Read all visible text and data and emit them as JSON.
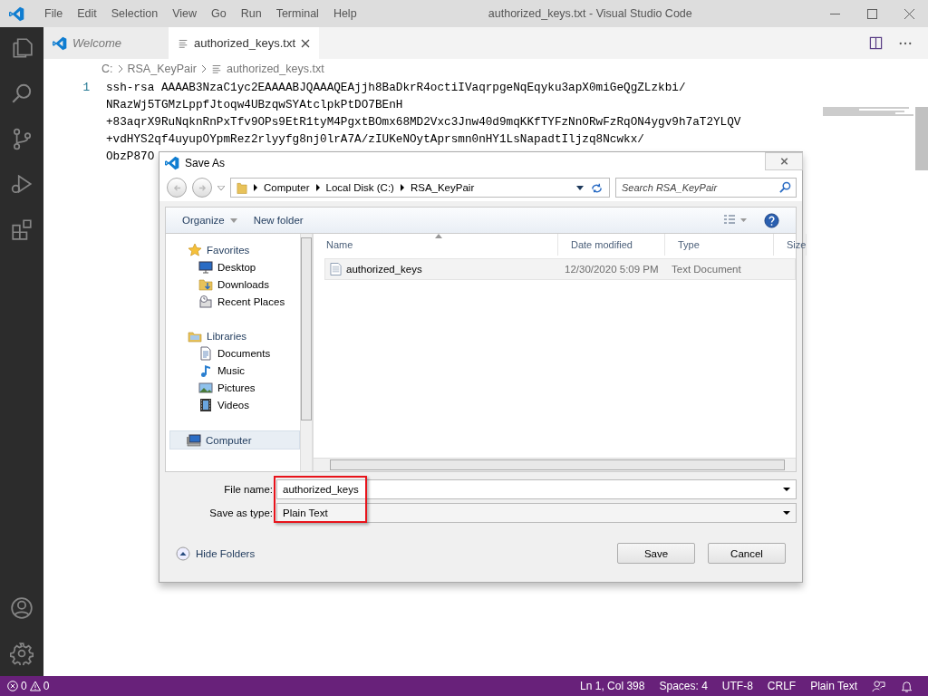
{
  "window": {
    "title": "authorized_keys.txt - Visual Studio Code"
  },
  "menu": [
    "File",
    "Edit",
    "Selection",
    "View",
    "Go",
    "Run",
    "Terminal",
    "Help"
  ],
  "activity_bar": [
    {
      "kind": "explorer"
    },
    {
      "kind": "search"
    },
    {
      "kind": "source-control"
    },
    {
      "kind": "run"
    },
    {
      "kind": "extensions"
    },
    {
      "kind": "account"
    },
    {
      "kind": "settings"
    }
  ],
  "tabs": [
    {
      "label": "Welcome",
      "kind": "welcome",
      "selected": false
    },
    {
      "label": "authorized_keys.txt",
      "kind": "text",
      "selected": true
    }
  ],
  "breadcrumb": [
    "C:",
    "RSA_KeyPair",
    "authorized_keys.txt"
  ],
  "editor": {
    "line_numbers": [
      "1"
    ],
    "lines": [
      "ssh-rsa AAAAB3NzaC1yc2EAAAABJQAAAQEAjjh8BaDkrR4octiIVaqrpgeNqEqyku3apX0miGeQgZLzkbi/",
      "NRazWj5TGMzLppfJtoqw4UBzqwSYAtclpkPtDO7BEnH",
      "+83aqrX9RuNqknRnPxTfv9OPs9EtR1tyM4PgxtBOmx68MD2Vxc3Jnw40d9mqKKfTYFzNnORwFzRqON4ygv9h7aT2YLQV",
      "+vdHYS2qf4uyupOYpmRez2rlyyfg8nj0lrA7A/zIUKeNOytAprsmn0nHY1LsNapadtIljzq8Ncwkx/",
      "ObzP87O"
    ]
  },
  "dialog": {
    "title": "Save As",
    "address": [
      "Computer",
      "Local Disk (C:)",
      "RSA_KeyPair"
    ],
    "search": {
      "placeholder": "Search RSA_KeyPair"
    },
    "toolbar": [
      "Organize",
      "New folder"
    ],
    "nav": [
      {
        "label": "Favorites",
        "kind": "favorites",
        "selected": false,
        "children": [
          {
            "label": "Desktop",
            "kind": "desktop",
            "selected": false
          },
          {
            "label": "Downloads",
            "kind": "downloads",
            "selected": false
          },
          {
            "label": "Recent Places",
            "kind": "recent",
            "selected": false
          }
        ]
      },
      {
        "label": "Libraries",
        "kind": "libraries",
        "selected": false,
        "children": [
          {
            "label": "Documents",
            "kind": "documents",
            "selected": false
          },
          {
            "label": "Music",
            "kind": "music",
            "selected": false
          },
          {
            "label": "Pictures",
            "kind": "pictures",
            "selected": false
          },
          {
            "label": "Videos",
            "kind": "videos",
            "selected": false
          }
        ]
      },
      {
        "label": "Computer",
        "kind": "computer",
        "selected": true
      }
    ],
    "columns": [
      "Name",
      "Date modified",
      "Type",
      "Size"
    ],
    "files": [
      {
        "name": "authorized_keys",
        "date": "12/30/2020 5:09 PM",
        "type": "Text Document",
        "selected": true
      }
    ],
    "file_name": {
      "label": "File name:",
      "value": "authorized_keys"
    },
    "save_as_type": {
      "label": "Save as type:",
      "value": "Plain Text"
    },
    "highlighted": true,
    "hide_folders": "Hide Folders",
    "buttons": [
      "Save",
      "Cancel"
    ]
  },
  "status_bar": {
    "errors": "0",
    "warnings": "0",
    "items": [
      "Ln 1, Col 398",
      "Spaces: 4",
      "UTF-8",
      "CRLF",
      "Plain Text"
    ]
  }
}
